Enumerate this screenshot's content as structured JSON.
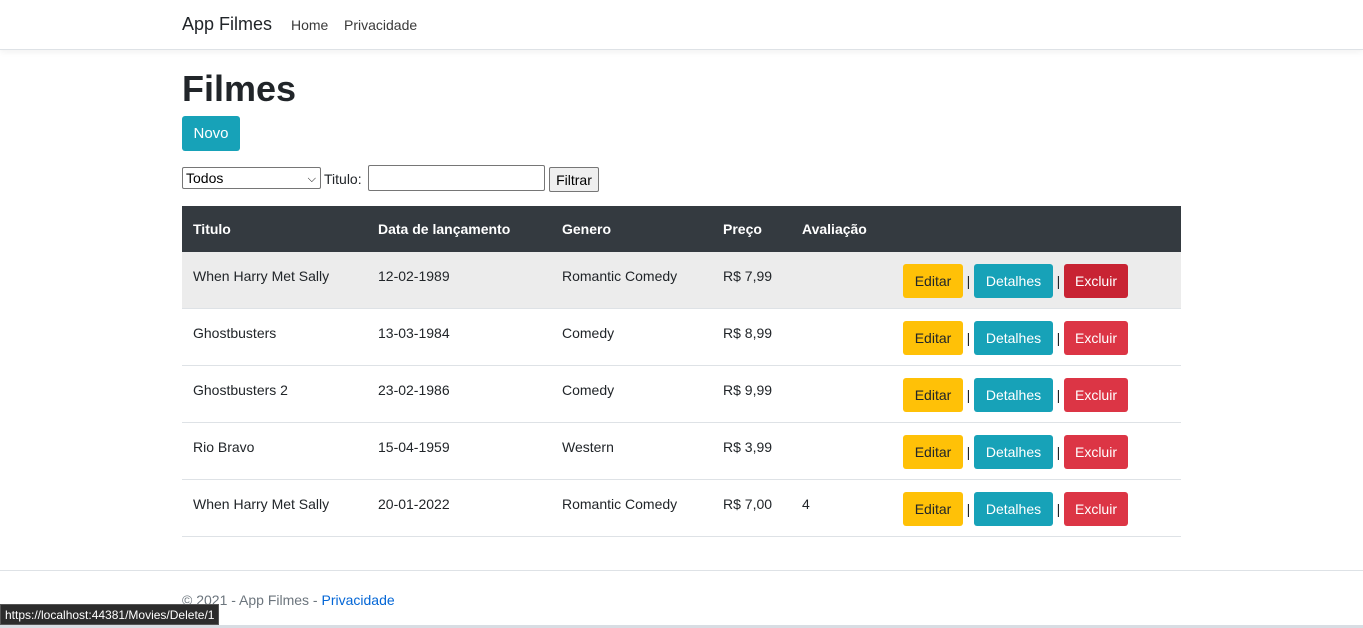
{
  "navbar": {
    "brand": "App Filmes",
    "links": [
      "Home",
      "Privacidade"
    ]
  },
  "page": {
    "title": "Filmes",
    "new_button": "Novo"
  },
  "filter": {
    "genre_selected": "Todos",
    "title_label": "Titulo:",
    "title_value": "",
    "submit_label": "Filtrar"
  },
  "table": {
    "headers": [
      "Titulo",
      "Data de lançamento",
      "Genero",
      "Preço",
      "Avaliação"
    ],
    "rows": [
      {
        "titulo": "When Harry Met Sally",
        "data": "12-02-1989",
        "genero": "Romantic Comedy",
        "preco": "R$ 7,99",
        "avaliacao": ""
      },
      {
        "titulo": "Ghostbusters",
        "data": "13-03-1984",
        "genero": "Comedy",
        "preco": "R$ 8,99",
        "avaliacao": ""
      },
      {
        "titulo": "Ghostbusters 2",
        "data": "23-02-1986",
        "genero": "Comedy",
        "preco": "R$ 9,99",
        "avaliacao": ""
      },
      {
        "titulo": "Rio Bravo",
        "data": "15-04-1959",
        "genero": "Western",
        "preco": "R$ 3,99",
        "avaliacao": ""
      },
      {
        "titulo": "When Harry Met Sally",
        "data": "20-01-2022",
        "genero": "Romantic Comedy",
        "preco": "R$ 7,00",
        "avaliacao": "4"
      }
    ],
    "actions": {
      "edit": "Editar",
      "details": "Detalhes",
      "delete": "Excluir",
      "separator": "|"
    }
  },
  "footer": {
    "text": "© 2021 - App Filmes - ",
    "link": "Privacidade"
  },
  "statusbar": {
    "url": "https://localhost:44381/Movies/Delete/1"
  },
  "colors": {
    "primary_info": "#17a2b8",
    "warning": "#ffc107",
    "danger": "#dc3545",
    "table_header": "#343a40"
  }
}
